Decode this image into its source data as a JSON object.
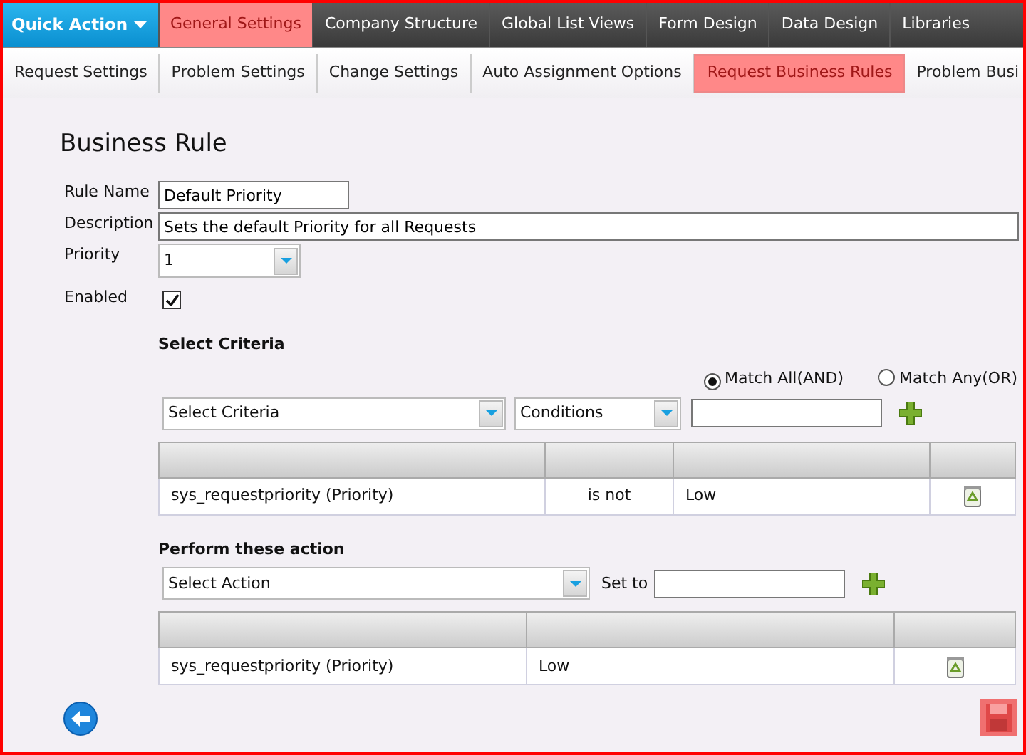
{
  "quick_action": {
    "label": "Quick Action"
  },
  "top_tabs": [
    {
      "label": "General Settings",
      "selected": true
    },
    {
      "label": "Company Structure",
      "selected": false
    },
    {
      "label": "Global List Views",
      "selected": false
    },
    {
      "label": "Form Design",
      "selected": false
    },
    {
      "label": "Data Design",
      "selected": false
    },
    {
      "label": "Libraries",
      "selected": false
    }
  ],
  "sub_tabs": [
    {
      "label": "Request Settings",
      "selected": false
    },
    {
      "label": "Problem Settings",
      "selected": false
    },
    {
      "label": "Change Settings",
      "selected": false
    },
    {
      "label": "Auto Assignment Options",
      "selected": false
    },
    {
      "label": "Request Business Rules",
      "selected": true
    },
    {
      "label": "Problem Busi",
      "selected": false
    }
  ],
  "title": "Business Rule",
  "form": {
    "rule_name": {
      "label": "Rule Name",
      "value": "Default Priority"
    },
    "description": {
      "label": "Description",
      "value": "Sets the default Priority for all Requests"
    },
    "priority": {
      "label": "Priority",
      "value": "1"
    },
    "enabled": {
      "label": "Enabled",
      "checked": true
    }
  },
  "criteria": {
    "heading": "Select Criteria",
    "match": [
      {
        "label": "Match All(AND)",
        "selected": true
      },
      {
        "label": "Match Any(OR)",
        "selected": false
      }
    ],
    "criteria_select": "Select Criteria",
    "conditions_select": "Conditions",
    "rows": [
      [
        "sys_requestpriority (Priority)",
        "is not",
        "Low"
      ]
    ]
  },
  "actions": {
    "heading": "Perform these action",
    "action_select": "Select Action",
    "set_to_label": "Set to",
    "rows": [
      [
        "sys_requestpriority (Priority)",
        "Low"
      ]
    ]
  }
}
